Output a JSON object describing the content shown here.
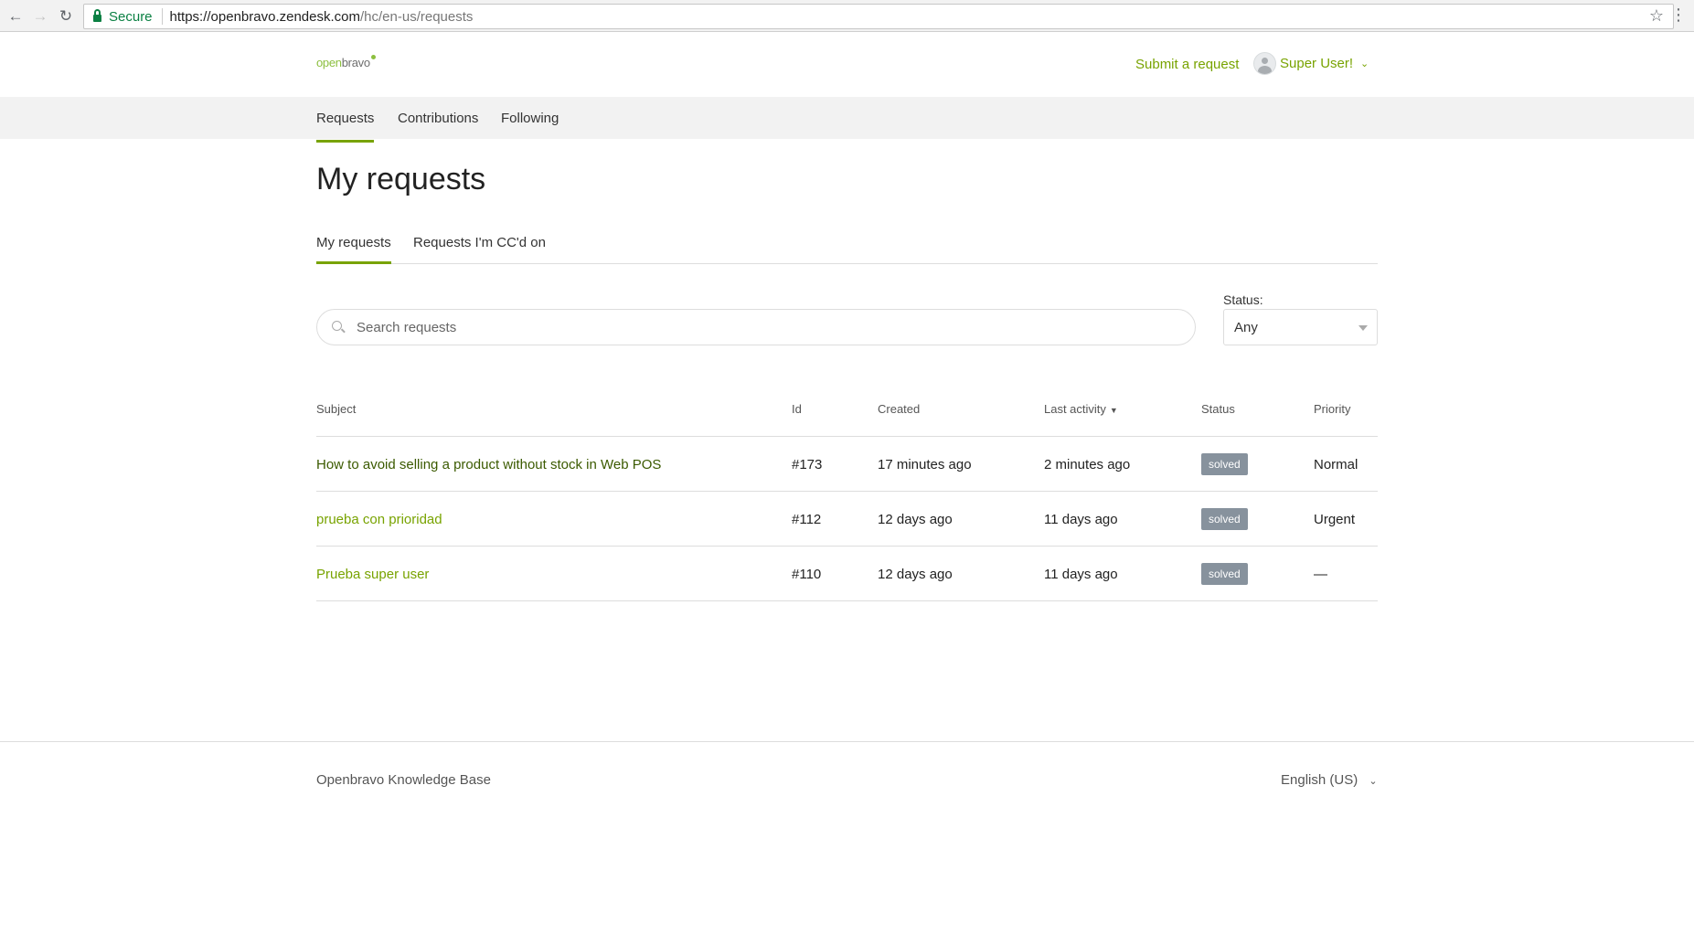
{
  "browser": {
    "secure_label": "Secure",
    "url_host": "https://openbravo.zendesk.com",
    "url_path": "/hc/en-us/requests"
  },
  "header": {
    "logo_open": "open",
    "logo_bravo": "bravo",
    "submit_request": "Submit a request",
    "user_name": "Super User!"
  },
  "subnav": {
    "items": [
      "Requests",
      "Contributions",
      "Following"
    ]
  },
  "page": {
    "title": "My requests"
  },
  "tabs": [
    "My requests",
    "Requests I'm CC'd on"
  ],
  "search": {
    "placeholder": "Search requests"
  },
  "filter": {
    "label": "Status:",
    "value": "Any"
  },
  "table": {
    "headers": {
      "subject": "Subject",
      "id": "Id",
      "created": "Created",
      "last_activity": "Last activity",
      "status": "Status",
      "priority": "Priority"
    },
    "rows": [
      {
        "subject": "How to avoid selling a product without stock in Web POS",
        "id": "#173",
        "created": "17 minutes ago",
        "last_activity": "2 minutes ago",
        "status": "solved",
        "priority": "Normal"
      },
      {
        "subject": "prueba con prioridad",
        "id": "#112",
        "created": "12 days ago",
        "last_activity": "11 days ago",
        "status": "solved",
        "priority": "Urgent"
      },
      {
        "subject": "Prueba super user",
        "id": "#110",
        "created": "12 days ago",
        "last_activity": "11 days ago",
        "status": "solved",
        "priority": "—"
      }
    ]
  },
  "footer": {
    "title": "Openbravo Knowledge Base",
    "language": "English (US)"
  },
  "colors": {
    "accent": "#78a300",
    "badge": "#87929d"
  }
}
